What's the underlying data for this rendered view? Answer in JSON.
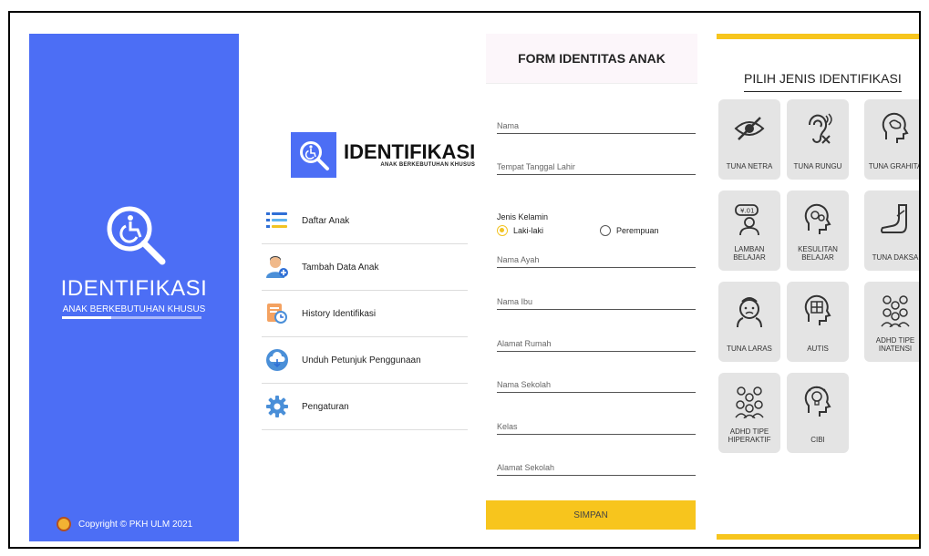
{
  "splash": {
    "title": "IDENTIFIKASI",
    "subtitle": "ANAK BERKEBUTUHAN KHUSUS",
    "progress": 0.35,
    "copyright": "Copyright © PKH ULM 2021",
    "color": "#4c6ef5"
  },
  "menu": {
    "brand_title": "IDENTIFIKASI",
    "brand_subtitle": "ANAK BERKEBUTUHAN KHUSUS",
    "items": [
      {
        "label": "Daftar Anak",
        "icon": "list-icon"
      },
      {
        "label": "Tambah Data Anak",
        "icon": "add-user-icon"
      },
      {
        "label": "History Identifikasi",
        "icon": "history-icon"
      },
      {
        "label": "Unduh Petunjuk Penggunaan",
        "icon": "cloud-download-icon"
      },
      {
        "label": "Pengaturan",
        "icon": "gear-icon"
      }
    ]
  },
  "form": {
    "title": "FORM IDENTITAS ANAK",
    "fields": {
      "nama": "Nama",
      "ttl": "Tempat Tanggal Lahir",
      "ayah": "Nama Ayah",
      "ibu": "Nama Ibu",
      "alamat": "Alamat Rumah",
      "sekolah": "Nama Sekolah",
      "kelas": "Kelas",
      "alamat_sekolah": "Alamat Sekolah"
    },
    "gender_label": "Jenis Kelamin",
    "gender_options": [
      "Laki-laki",
      "Perempuan"
    ],
    "gender_selected": "Laki-laki",
    "save_label": "SIMPAN",
    "accent": "#f7c51d"
  },
  "pick": {
    "title": "PILIH JENIS IDENTIFIKASI",
    "tiles": [
      {
        "label": "TUNA NETRA",
        "icon": "eye-slash-icon"
      },
      {
        "label": "TUNA RUNGU",
        "icon": "deaf-ear-icon"
      },
      {
        "label": "TUNA GRAHITA",
        "icon": "head-brain-icon"
      },
      {
        "label": "LAMBAN BELAJAR",
        "icon": "slow-learner-icon"
      },
      {
        "label": "KESULITAN BELAJAR",
        "icon": "head-gears-icon"
      },
      {
        "label": "TUNA DAKSA",
        "icon": "leg-icon"
      },
      {
        "label": "TUNA LARAS",
        "icon": "emotional-face-icon"
      },
      {
        "label": "AUTIS",
        "icon": "puzzle-head-icon"
      },
      {
        "label": "ADHD TIPE INATENSI",
        "icon": "group-thinking-icon"
      },
      {
        "label": "ADHD TIPE HIPERAKTIF",
        "icon": "group-active-icon"
      },
      {
        "label": "CIBI",
        "icon": "lightbulb-head-icon"
      }
    ]
  }
}
